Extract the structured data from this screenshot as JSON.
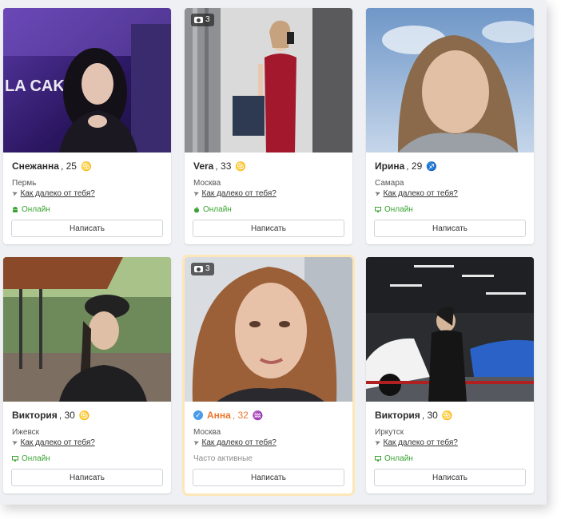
{
  "cards": [
    {
      "name": "Снежанна",
      "age_text": ", 25",
      "sign": "♋",
      "city": "Пермь",
      "distance": "Как далеко от тебя?",
      "status": "Онлайн",
      "device": "android",
      "button": "Написать"
    },
    {
      "name": "Vera",
      "age_text": ", 33",
      "sign": "♋",
      "city": "Москва",
      "distance": "Как далеко от тебя?",
      "status": "Онлайн",
      "device": "apple",
      "button": "Написать",
      "photo_count": "3"
    },
    {
      "name": "Ирина",
      "age_text": ", 29",
      "sign": "♐",
      "city": "Самара",
      "distance": "Как далеко от тебя?",
      "status": "Онлайн",
      "device": "desktop",
      "button": "Написать"
    },
    {
      "name": "Виктория",
      "age_text": ", 30",
      "sign": "♋",
      "city": "Ижевск",
      "distance": "Как далеко от тебя?",
      "status": "Онлайн",
      "device": "desktop",
      "button": "Написать"
    },
    {
      "name": "Анна",
      "age_text": ", 32",
      "sign": "♒",
      "city": "Москва",
      "distance": "Как далеко от тебя?",
      "status": "Часто активные",
      "device": "none",
      "button": "Написать",
      "photo_count": "3",
      "verified": true,
      "highlight": true
    },
    {
      "name": "Виктория",
      "age_text": ", 30",
      "sign": "♋",
      "city": "Иркутск",
      "distance": "Как далеко от тебя?",
      "status": "Онлайн",
      "device": "desktop",
      "button": "Написать"
    }
  ],
  "colors": {
    "online": "#3aa333",
    "accent": "#e8772e",
    "verified": "#4a9be8"
  }
}
